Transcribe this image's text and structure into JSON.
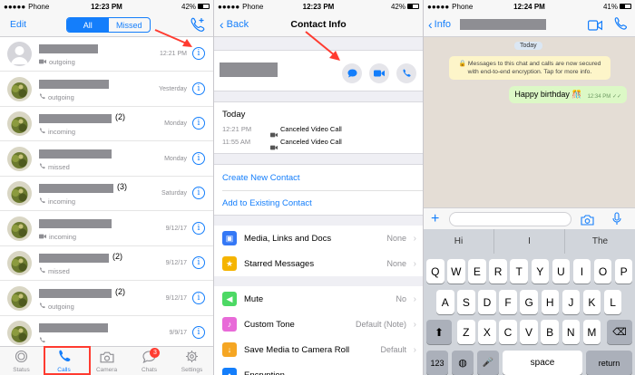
{
  "panel1": {
    "status": {
      "carrier": "Phone",
      "time": "12:23 PM",
      "battery": "42%",
      "battery_level": 0.42
    },
    "nav": {
      "edit": "Edit",
      "seg_all": "All",
      "seg_missed": "Missed"
    },
    "calls": [
      {
        "count": "",
        "type": "outgoing",
        "kind": "video",
        "time": "12:21 PM",
        "avatar": "placeholder"
      },
      {
        "count": "",
        "type": "outgoing",
        "kind": "voice",
        "time": "Yesterday",
        "avatar": "photo"
      },
      {
        "count": "(2)",
        "type": "incoming",
        "kind": "voice",
        "time": "Monday",
        "avatar": "photo"
      },
      {
        "count": "",
        "type": "missed",
        "kind": "voice",
        "time": "Monday",
        "avatar": "photo"
      },
      {
        "count": "(3)",
        "type": "incoming",
        "kind": "voice",
        "time": "Saturday",
        "avatar": "photo"
      },
      {
        "count": "",
        "type": "incoming",
        "kind": "video",
        "time": "9/12/17",
        "avatar": "photo"
      },
      {
        "count": "(2)",
        "type": "missed",
        "kind": "voice",
        "time": "9/12/17",
        "avatar": "photo"
      },
      {
        "count": "(2)",
        "type": "outgoing",
        "kind": "voice",
        "time": "9/12/17",
        "avatar": "photo"
      },
      {
        "count": "",
        "type": "",
        "kind": "voice",
        "time": "9/9/17",
        "avatar": "photo"
      }
    ],
    "tabs": [
      {
        "label": "Status",
        "icon": "status-icon"
      },
      {
        "label": "Calls",
        "icon": "phone-icon"
      },
      {
        "label": "Camera",
        "icon": "camera-icon"
      },
      {
        "label": "Chats",
        "icon": "chats-icon",
        "badge": "3"
      },
      {
        "label": "Settings",
        "icon": "gear-icon"
      }
    ]
  },
  "panel2": {
    "status": {
      "carrier": "Phone",
      "time": "12:23 PM",
      "battery": "42%",
      "battery_level": 0.42
    },
    "nav": {
      "back": "Back",
      "title": "Contact Info"
    },
    "history": {
      "day": "Today",
      "entries": [
        {
          "time": "12:21 PM",
          "label": "Canceled Video Call"
        },
        {
          "time": "11:55 AM",
          "label": "Canceled Video Call"
        }
      ]
    },
    "actions": {
      "create": "Create New Contact",
      "add": "Add to Existing Contact"
    },
    "settings": [
      {
        "label": "Media, Links and Docs",
        "value": "None",
        "icon": "photo-icon",
        "color": "#3478f6"
      },
      {
        "label": "Starred Messages",
        "value": "None",
        "icon": "star-icon",
        "color": "#f5b400"
      },
      {
        "label": "Mute",
        "value": "No",
        "icon": "speaker-icon",
        "color": "#4cd964"
      },
      {
        "label": "Custom Tone",
        "value": "Default (Note)",
        "icon": "music-icon",
        "color": "#e86ad8"
      },
      {
        "label": "Save Media to Camera Roll",
        "value": "Default",
        "icon": "download-icon",
        "color": "#f5a623"
      },
      {
        "label": "Encryption",
        "value": "",
        "icon": "lock-icon",
        "color": "#147efb"
      }
    ]
  },
  "panel3": {
    "status": {
      "carrier": "Phone",
      "time": "12:24 PM",
      "battery": "41%",
      "battery_level": 0.41
    },
    "nav": {
      "back": "Info"
    },
    "date": "Today",
    "encryption_notice": "Messages to this chat and calls are now secured with end-to-end encryption. Tap for more info.",
    "message": {
      "text": "Happy birthday 🎊",
      "time": "12:34 PM ✓✓"
    },
    "suggestions": [
      "Hi",
      "I",
      "The"
    ],
    "rows": [
      [
        "Q",
        "W",
        "E",
        "R",
        "T",
        "Y",
        "U",
        "I",
        "O",
        "P"
      ],
      [
        "A",
        "S",
        "D",
        "F",
        "G",
        "H",
        "J",
        "K",
        "L"
      ],
      [
        "Z",
        "X",
        "C",
        "V",
        "B",
        "N",
        "M"
      ]
    ],
    "keys": {
      "numbers": "123",
      "space": "space",
      "return": "return"
    }
  },
  "colors": {
    "accent": "#147efb",
    "annotation": "#ff3b30",
    "bubble": "#dcf8c6"
  }
}
